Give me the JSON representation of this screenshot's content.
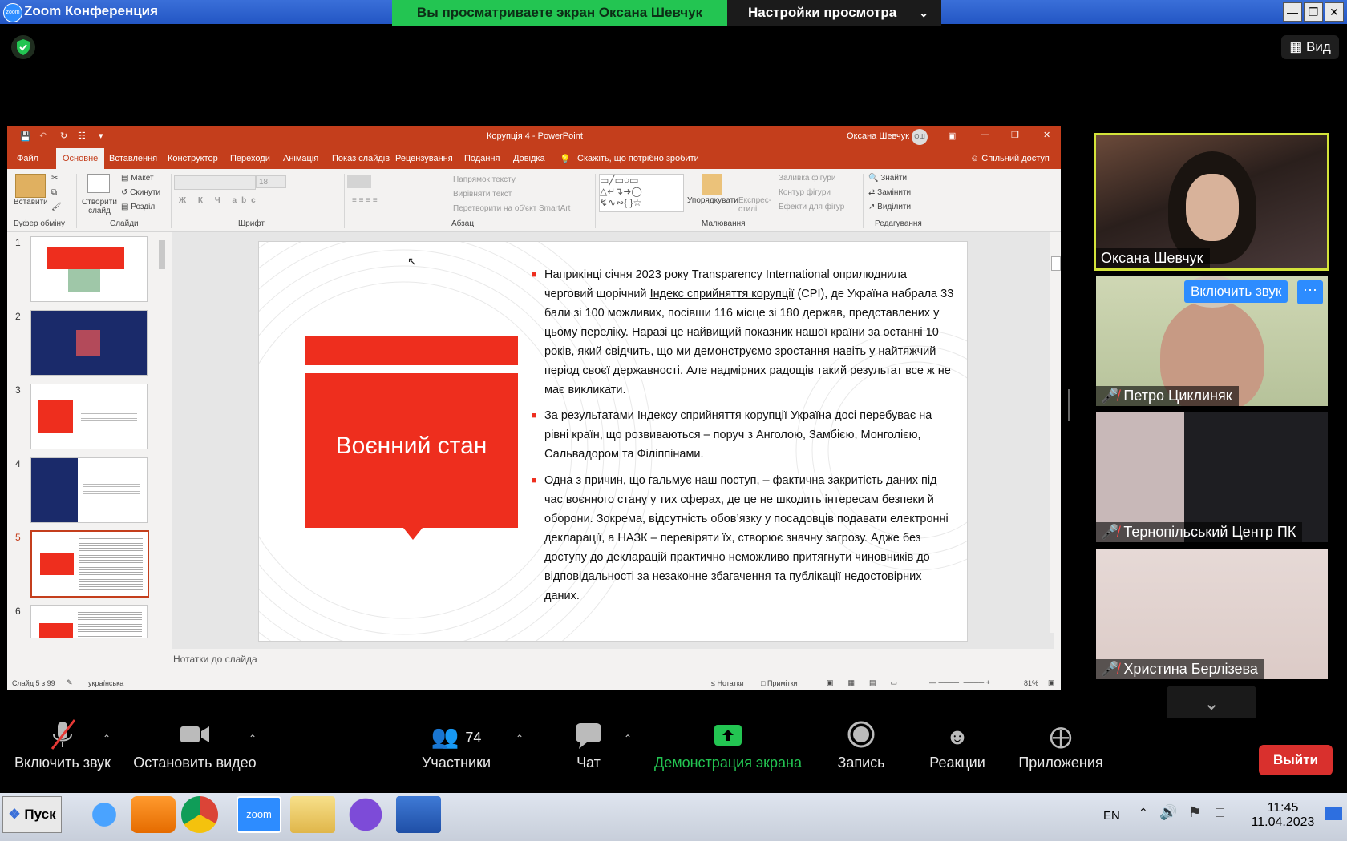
{
  "zoom": {
    "app_title": "Zoom Конференция",
    "logo_text": "zoom",
    "share_banner": "Вы просматриваете экран Оксана Шевчук",
    "view_settings": "Настройки просмотра",
    "view_button": "Вид"
  },
  "ppt": {
    "title": "Корупція 4 - PowerPoint",
    "user": "Оксана Шевчук",
    "user_initials": "ОШ",
    "tabs": [
      "Файл",
      "Основне",
      "Вставлення",
      "Конструктор",
      "Переходи",
      "Анімація",
      "Показ слайдів",
      "Рецензування",
      "Подання",
      "Довідка"
    ],
    "tell_me": "Скажіть, що потрібно зробити",
    "share": "Спільний доступ",
    "ribbon": {
      "paste": "Вставити",
      "clipboard": "Буфер обміну",
      "new_slide": "Створити слайд",
      "layout": "Макет",
      "reset": "Скинути",
      "section": "Розділ",
      "slides": "Слайди",
      "font_size": "18",
      "font": "Шрифт",
      "text_direction": "Напрямок тексту",
      "align_text": "Вирівняти текст",
      "smartart": "Перетворити на об'єкт SmartArt",
      "paragraph": "Абзац",
      "arrange": "Упорядкувати",
      "quick_styles": "Експрес-стилі",
      "shape_fill": "Заливка фігури",
      "shape_outline": "Контур фігури",
      "shape_effects": "Ефекти для фігур",
      "drawing": "Малювання",
      "find": "Знайти",
      "replace": "Замінити",
      "select": "Виділити",
      "editing": "Редагування"
    },
    "thumb_numbers": [
      "1",
      "2",
      "3",
      "4",
      "5",
      "6"
    ],
    "slide": {
      "title": "Воєнний стан",
      "bullet1_a": "Наприкінці січня 2023 року Transparency International оприлюднила черговий щорічний ",
      "bullet1_link": "Індекс сприйняття корупції",
      "bullet1_b": " (CPI), де Україна набрала 33 бали зі 100 можливих, посівши 116 місце зі 180 держав, представлених у цьому переліку. Наразі це найвищий показник нашої країни за останні 10 років, який свідчить, що ми демонструємо зростання навіть у найтяжчий період своєї державності. Але надмірних радощів такий результат все ж не має викликати.",
      "bullet2": "За результатами Індексу сприйняття корупції Україна досі перебуває на рівні країн, що розвиваються – поруч з Анголою, Замбією, Монголією, Сальвадором та Філіппінами.",
      "bullet3": "Одна з причин, що гальмує наш поступ, – фактична закритість даних під час воєнного стану у тих сферах, де це не шкодить інтересам безпеки й оборони. Зокрема, відсутність обов’язку у посадовців подавати електронні декларації, а НАЗК – перевіряти їх, створює значну загрозу. Адже без доступу до декларацій практично неможливо притягнути чиновників до відповідальності за незаконне збагачення та публікації недостовірних даних."
    },
    "notes": "Нотатки до слайда",
    "status": {
      "slide_of": "Слайд 5 з 99",
      "language": "українська",
      "notes": "Нотатки",
      "comments": "Примітки",
      "zoom": "81%"
    }
  },
  "participants": [
    {
      "name": "Оксана Шевчук"
    },
    {
      "name": "Петро Циклиняк",
      "unmute": "Включить звук"
    },
    {
      "name": "Тернопільський Центр ПК"
    },
    {
      "name": "Христина Берлізева"
    }
  ],
  "toolbar": {
    "unmute": "Включить звук",
    "stop_video": "Остановить видео",
    "participants": "Участники",
    "participants_count": "74",
    "chat": "Чат",
    "share_screen": "Демонстрация экрана",
    "record": "Запись",
    "reactions": "Реакции",
    "apps": "Приложения",
    "leave": "Выйти"
  },
  "taskbar": {
    "start": "Пуск",
    "lang": "EN",
    "time": "11:45",
    "date": "11.04.2023"
  }
}
